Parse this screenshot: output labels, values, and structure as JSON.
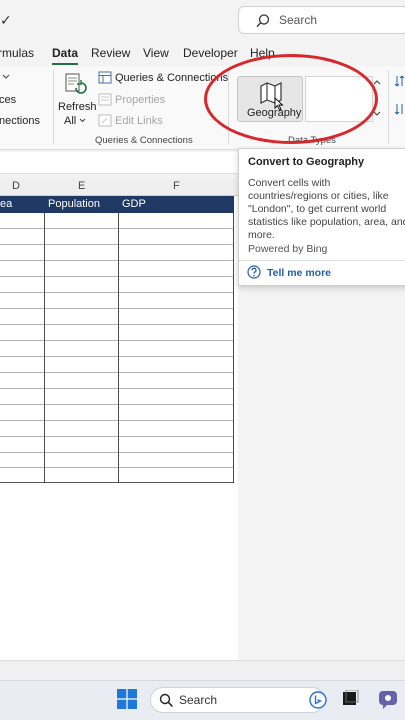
{
  "header": {
    "search_placeholder": "Search",
    "check_glyph": "✓"
  },
  "tabs": [
    {
      "label": "rmulas"
    },
    {
      "label": "Data",
      "active": true
    },
    {
      "label": "Review"
    },
    {
      "label": "View"
    },
    {
      "label": "Developer"
    },
    {
      "label": "Help"
    }
  ],
  "ribbon": {
    "left_fragments": {
      "ces": "ces",
      "nections": "nections"
    },
    "refresh_label_line1": "Refresh",
    "refresh_label_line2": "All",
    "queries_connections": "Queries & Connections",
    "properties": "Properties",
    "edit_links": "Edit Links",
    "group_queries": "Queries & Connections",
    "geography_label": "Geography",
    "group_data_types": "Data Types"
  },
  "sheet": {
    "columns": [
      "D",
      "E",
      "F"
    ],
    "table_headers": [
      "ea",
      "Population",
      "GDP"
    ]
  },
  "tooltip": {
    "title": "Convert to Geography",
    "body": "Convert cells with countries/regions or cities, like \"London\", to get current world statistics like population, area, and more.",
    "powered_by": "Powered by Bing",
    "link": "Tell me more"
  },
  "taskbar": {
    "search_label": "Search"
  },
  "colors": {
    "table_header_bg": "#1f3864",
    "accent_green": "#217346",
    "annotation_red": "#d8262a",
    "link_blue": "#1f5fad"
  }
}
